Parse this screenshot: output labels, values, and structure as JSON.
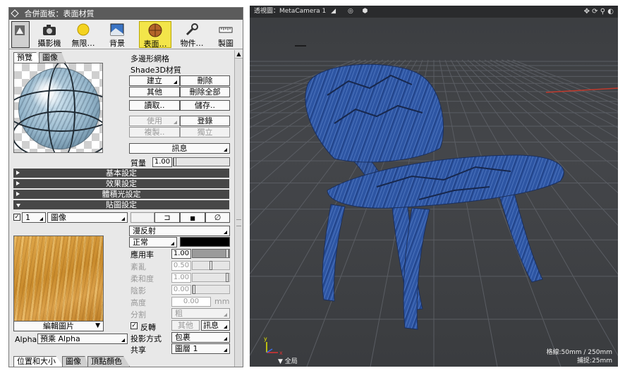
{
  "panel": {
    "title": "合併面板：表面材質",
    "toolbar": [
      {
        "label": "",
        "icon": "object-icon"
      },
      {
        "label": "攝影機",
        "icon": "camera-icon"
      },
      {
        "label": "無限…",
        "icon": "sun-icon"
      },
      {
        "label": "背景",
        "icon": "background-icon"
      },
      {
        "label": "表面…",
        "icon": "sphere-material-icon"
      },
      {
        "label": "物件…",
        "icon": "wrench-icon"
      },
      {
        "label": "製圖",
        "icon": "ruler-icon"
      }
    ],
    "preview_tabs": [
      "預覽",
      "圖像"
    ],
    "object_type": "多邊形網格",
    "material_name": "Shade3D材質",
    "buttons": {
      "create": "建立",
      "delete": "刪除",
      "other": "其他",
      "delete_all": "刪除全部",
      "read": "讀取..",
      "save": "儲存..",
      "use": "使用",
      "register": "登錄",
      "copy": "複製..",
      "unique": "獨立",
      "info": "訊息"
    },
    "mass_label": "質量",
    "mass_value": "1.00",
    "sections": [
      "基本設定",
      "效果設定",
      "體積光設定",
      "貼圖設定"
    ],
    "mapping": {
      "layer_index": "1",
      "layer_type": "圖像",
      "channel": "漫反射",
      "blend": "正常",
      "color_hex": "#000000",
      "rows": [
        {
          "label": "應用率",
          "value": "1.00",
          "level": 1.0,
          "enabled": true
        },
        {
          "label": "紊亂",
          "value": "0.50",
          "level": 0.5,
          "enabled": false
        },
        {
          "label": "柔和度",
          "value": "1.00",
          "level": 1.0,
          "enabled": false
        },
        {
          "label": "陰影",
          "value": "0.00",
          "level": 0.0,
          "enabled": false
        }
      ],
      "height_label": "高度",
      "height_value": "0.00",
      "height_unit": "mm",
      "split_label": "分割",
      "split_value": "粗",
      "edit_image": "編輯圖片",
      "invert_label": "反轉",
      "other_button": "其他",
      "info_button": "訊息",
      "alpha_label": "Alpha",
      "alpha_value": "預乘 Alpha",
      "projection_label": "投影方式",
      "projection_value": "包裹",
      "share_label": "共享",
      "share_value": "圖層 1"
    },
    "bottom_tabs": [
      "位置和大小",
      "圖像",
      "頂點顏色"
    ]
  },
  "viewport": {
    "title": "透視圖：MetaCamera 1",
    "grid_info": "格線:50mm / 250mm",
    "snap_info": "捕捉:25mm",
    "scope": "▼ 全局",
    "colors": {
      "chair": "#2f5aa8",
      "grid": "#5a5d63"
    }
  }
}
